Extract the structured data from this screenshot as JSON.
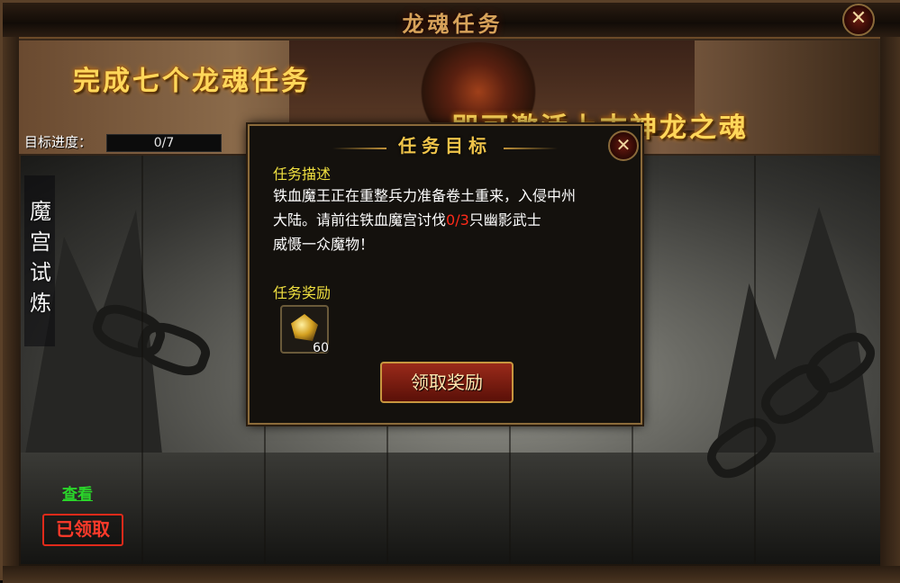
{
  "window": {
    "title": "龙魂任务",
    "close_label": "✕"
  },
  "banner": {
    "line1": "完成七个龙魂任务",
    "line2": "即可激活上古神龙之魂"
  },
  "progress": {
    "label": "目标进度：",
    "value": "0/7"
  },
  "side_tab": {
    "chars": [
      "魔",
      "宫",
      "试",
      "炼"
    ]
  },
  "view_link": "查看",
  "claimed_stamp": "已领取",
  "dialog": {
    "title": "任务目标",
    "close_label": "✕",
    "desc_label": "任务描述",
    "desc_line1": "铁血魔王正在重整兵力准备卷土重来，入侵中州",
    "desc_line2_pre": "大陆。请前往铁血魔宫讨伐",
    "desc_count": "0/3",
    "desc_line2_post": "只幽影武士",
    "desc_line3": "威慑一众魔物！",
    "reward_label": "任务奖励",
    "reward_item": {
      "icon": "gold-ingot-icon",
      "quantity": "60"
    },
    "claim_button": "领取奖励"
  },
  "colors": {
    "accent_gold": "#f0c44a",
    "highlight_red": "#ff2a1a",
    "link_green": "#2ad62a"
  }
}
